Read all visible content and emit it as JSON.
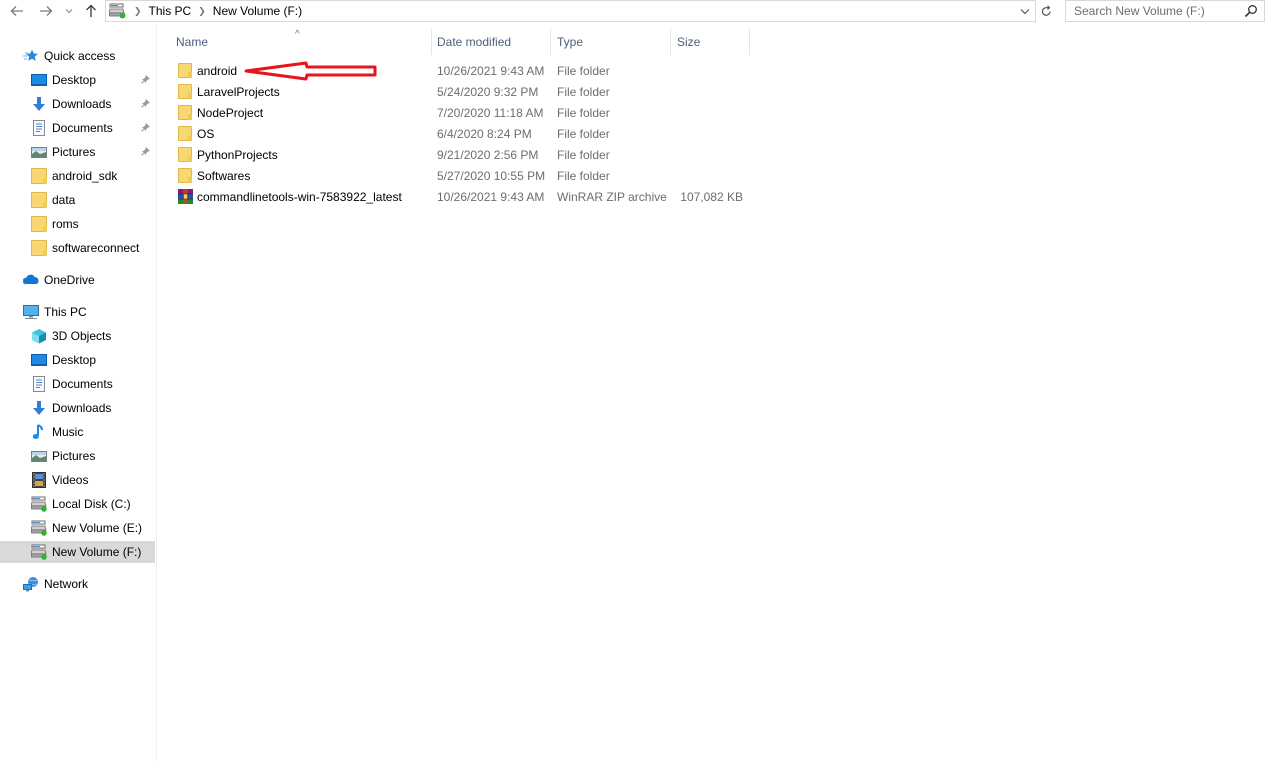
{
  "toolbar": {
    "back_icon": "arrow-left-icon",
    "forward_icon": "arrow-right-icon",
    "recent_icon": "chevron-down-icon",
    "up_icon": "arrow-up-icon",
    "breadcrumb": [
      "This PC",
      "New Volume (F:)"
    ],
    "refresh_icon": "refresh-icon",
    "search_placeholder": "Search New Volume (F:)"
  },
  "nav": {
    "quick_access": {
      "label": "Quick access",
      "items": [
        {
          "label": "Desktop",
          "icon": "desktop-icon",
          "pinned": true
        },
        {
          "label": "Downloads",
          "icon": "downloads-icon",
          "pinned": true
        },
        {
          "label": "Documents",
          "icon": "documents-icon",
          "pinned": true
        },
        {
          "label": "Pictures",
          "icon": "pictures-icon",
          "pinned": true
        },
        {
          "label": "android_sdk",
          "icon": "folder-icon",
          "pinned": false
        },
        {
          "label": "data",
          "icon": "folder-icon",
          "pinned": false
        },
        {
          "label": "roms",
          "icon": "folder-icon",
          "pinned": false
        },
        {
          "label": "softwareconnect",
          "icon": "folder-icon",
          "pinned": false
        }
      ]
    },
    "onedrive": {
      "label": "OneDrive"
    },
    "this_pc": {
      "label": "This PC",
      "items": [
        {
          "label": "3D Objects",
          "icon": "3d-objects-icon"
        },
        {
          "label": "Desktop",
          "icon": "desktop-icon"
        },
        {
          "label": "Documents",
          "icon": "documents-icon"
        },
        {
          "label": "Downloads",
          "icon": "downloads-icon"
        },
        {
          "label": "Music",
          "icon": "music-icon"
        },
        {
          "label": "Pictures",
          "icon": "pictures-icon"
        },
        {
          "label": "Videos",
          "icon": "videos-icon"
        },
        {
          "label": "Local Disk (C:)",
          "icon": "drive-icon"
        },
        {
          "label": "New Volume (E:)",
          "icon": "drive-icon"
        },
        {
          "label": "New Volume (F:)",
          "icon": "drive-icon",
          "selected": true
        }
      ]
    },
    "network": {
      "label": "Network"
    }
  },
  "list": {
    "columns": {
      "name": "Name",
      "date": "Date modified",
      "type": "Type",
      "size": "Size"
    },
    "sort_indicator": "^",
    "rows": [
      {
        "name": "android",
        "date": "10/26/2021 9:43 AM",
        "type": "File folder",
        "size": "",
        "icon": "folder-icon"
      },
      {
        "name": "LaravelProjects",
        "date": "5/24/2020 9:32 PM",
        "type": "File folder",
        "size": "",
        "icon": "folder-icon"
      },
      {
        "name": "NodeProject",
        "date": "7/20/2020 11:18 AM",
        "type": "File folder",
        "size": "",
        "icon": "folder-icon"
      },
      {
        "name": "OS",
        "date": "6/4/2020 8:24 PM",
        "type": "File folder",
        "size": "",
        "icon": "folder-icon"
      },
      {
        "name": "PythonProjects",
        "date": "9/21/2020 2:56 PM",
        "type": "File folder",
        "size": "",
        "icon": "folder-icon"
      },
      {
        "name": "Softwares",
        "date": "5/27/2020 10:55 PM",
        "type": "File folder",
        "size": "",
        "icon": "folder-icon"
      },
      {
        "name": "commandlinetools-win-7583922_latest",
        "date": "10/26/2021 9:43 AM",
        "type": "WinRAR ZIP archive",
        "size": "107,082 KB",
        "icon": "winrar-archive-icon"
      }
    ]
  },
  "annotation": {
    "target": "android",
    "color": "#e8141c"
  }
}
